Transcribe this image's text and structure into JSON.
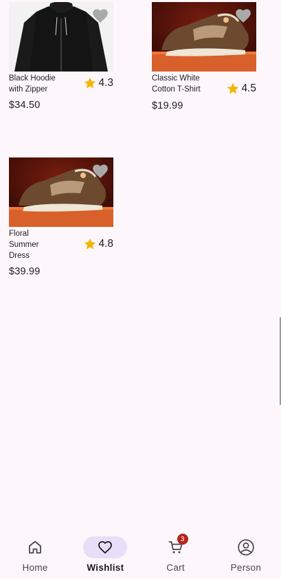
{
  "products": [
    {
      "name": "Black Hoodie with Zipper",
      "rating": "4.3",
      "price": "$34.50",
      "image": "black-hoodie"
    },
    {
      "name": "Classic White Cotton T-Shirt",
      "rating": "4.5",
      "price": "$19.99",
      "image": "sneaker"
    },
    {
      "name": "Floral Summer Dress",
      "rating": "4.8",
      "price": "$39.99",
      "image": "sneaker"
    }
  ],
  "nav": {
    "items": [
      {
        "label": "Home",
        "icon": "home-icon"
      },
      {
        "label": "Wishlist",
        "icon": "heart-icon",
        "active": true
      },
      {
        "label": "Cart",
        "icon": "cart-icon",
        "badge": "3"
      },
      {
        "label": "Person",
        "icon": "person-icon"
      }
    ]
  },
  "colors": {
    "background": "#fdf7fc",
    "active_pill": "#e8def8",
    "star": "#f5b400",
    "badge": "#b3261e",
    "favorite_heart": "#a9a9a9"
  }
}
